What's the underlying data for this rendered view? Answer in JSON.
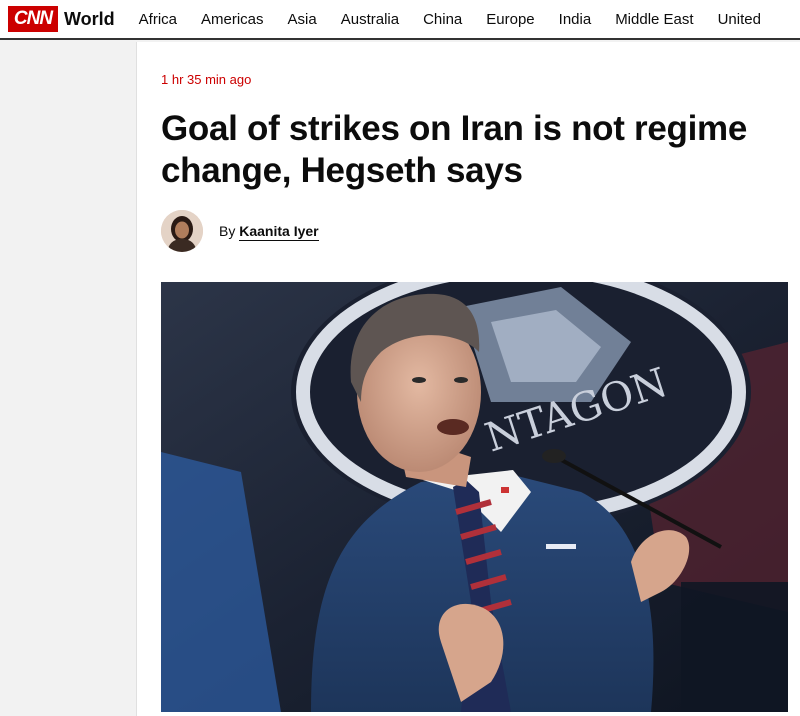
{
  "brand": {
    "logo_text": "CNN",
    "section": "World",
    "accent": "#cc0000"
  },
  "nav": {
    "items": [
      "Africa",
      "Americas",
      "Asia",
      "Australia",
      "China",
      "Europe",
      "India",
      "Middle East",
      "United"
    ]
  },
  "article": {
    "timestamp": "1 hr 35 min ago",
    "headline": "Goal of strikes on Iran is not regime change, Hegseth says",
    "byline_prefix": "By",
    "author": "Kaanita Iyer"
  },
  "hero_image": {
    "sign_text": "NTAGON"
  }
}
